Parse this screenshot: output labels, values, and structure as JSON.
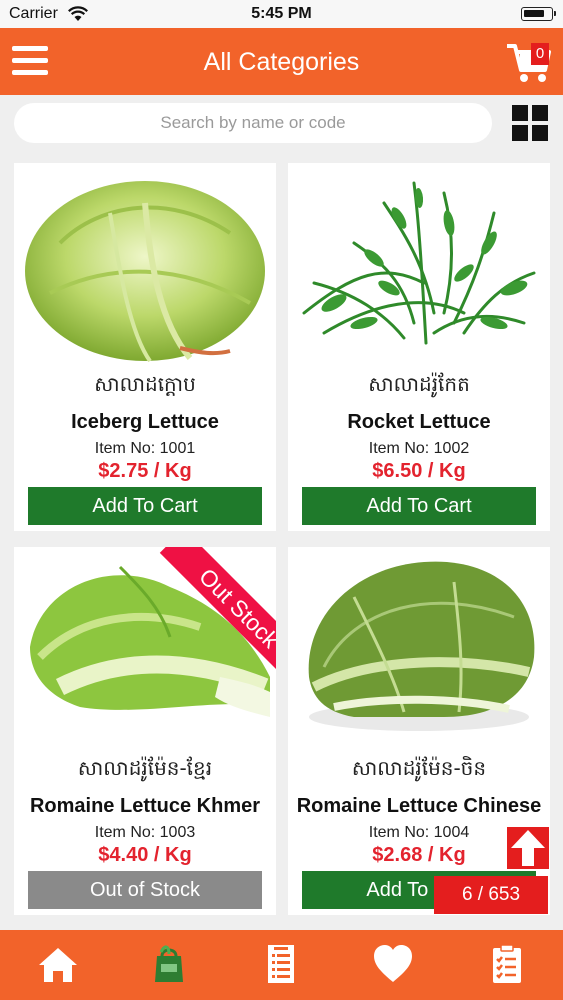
{
  "status_bar": {
    "carrier": "Carrier",
    "time": "5:45 PM"
  },
  "header": {
    "title": "All Categories",
    "cart_count": "0",
    "accent_color": "#f2632a"
  },
  "search": {
    "placeholder": "Search by name or code"
  },
  "products": [
    {
      "name_kh": "សាលាដក្តោប",
      "name_en": "Iceberg Lettuce",
      "item_no": "Item No: 1001",
      "price": "$2.75 / Kg",
      "button": "Add To Cart",
      "in_stock": true
    },
    {
      "name_kh": "សាលាដរ៉ូកែត",
      "name_en": "Rocket Lettuce",
      "item_no": "Item No: 1002",
      "price": "$6.50 / Kg",
      "button": "Add To Cart",
      "in_stock": true
    },
    {
      "name_kh": "សាលាដរ៉ូម៉ែន-ខ្មែរ",
      "name_en": "Romaine Lettuce Khmer",
      "item_no": "Item No: 1003",
      "price": "$4.40 / Kg",
      "button": "Out of Stock",
      "in_stock": false,
      "ribbon": "Out Stock"
    },
    {
      "name_kh": "សាលាដរ៉ូម៉ែន-ចិន",
      "name_en": "Romaine Lettuce Chinese",
      "item_no": "Item No: 1004",
      "price": "$2.68 / Kg",
      "button": "Add To Cart",
      "in_stock": true
    }
  ],
  "pagination": {
    "counter": "6 / 653"
  },
  "bottom_nav": [
    "home-icon",
    "grocery-bag-icon",
    "menu-list-icon",
    "heart-icon",
    "clipboard-icon"
  ],
  "colors": {
    "add_button": "#1f7a2b",
    "out_button": "#8a8a8a",
    "price": "#e3232e",
    "badge": "#e41e1e",
    "ribbon": "#ef1144"
  }
}
